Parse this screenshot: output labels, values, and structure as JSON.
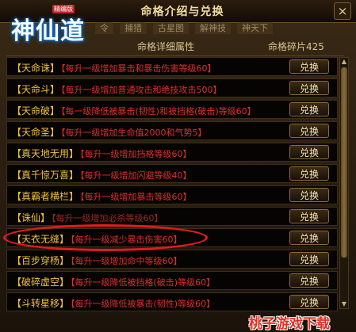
{
  "window": {
    "title": "命格介绍与兑换",
    "close_label": "×"
  },
  "logo": {
    "text": "神仙道",
    "badge": "精编版"
  },
  "tabs": [
    "令",
    "捕猎",
    "古星图",
    "解神技",
    "神天下"
  ],
  "header": {
    "detail_label": "命格详细属性",
    "fragment_label": "命格碎片",
    "fragment_count": "425"
  },
  "button_label": "兑换",
  "items": [
    {
      "name": "【天命诛】",
      "desc": "【每升一级增加暴击和暴击伤害等级60】"
    },
    {
      "name": "【天命斗】",
      "desc": "【每升一级增加普通攻击和绝技攻击500】"
    },
    {
      "name": "【天命破】",
      "desc": "【每一级降低被暴击(韧性)和被挡格(破击)等级60】"
    },
    {
      "name": "【天命圣】",
      "desc": "【每升一级增加生命值2000和气势5】"
    },
    {
      "name": "【真天地无用】",
      "desc": "【每升一级增加挡格等级60】"
    },
    {
      "name": "【真千惊万喜】",
      "desc": "【每升一级增加闪避等级40】"
    },
    {
      "name": "【真霸者横栏】",
      "desc": "【每升一级增加暴击等级60】"
    },
    {
      "name": "【诛仙】",
      "desc": "【每升一级增加必杀等级60】"
    },
    {
      "name": "【天衣无缝】",
      "desc": "【每升一级减少暴击伤害60】"
    },
    {
      "name": "【百步穿杨】",
      "desc": "【每升一级增加命中等级60】"
    },
    {
      "name": "【破碎虚空】",
      "desc": "【每升一级降低被挡格(破击)等级60】"
    },
    {
      "name": "【斗转星移】",
      "desc": "【每升一级降低被暴击(韧性)等级60】"
    }
  ],
  "watermark": "桃子游戏下载",
  "colors": {
    "name": "#f2c23a",
    "desc": "#e12d2d",
    "highlight": "#e01c1c"
  }
}
